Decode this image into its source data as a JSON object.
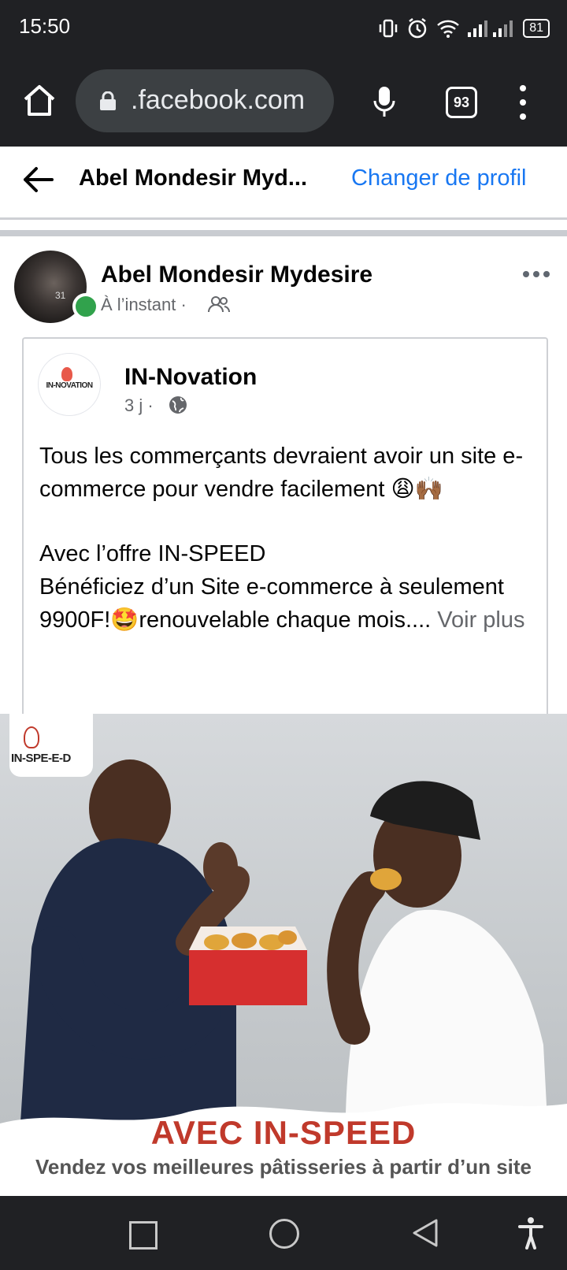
{
  "status_bar": {
    "time": "15:50",
    "battery": "81"
  },
  "browser": {
    "url": ".facebook.com",
    "tab_count": "93",
    "icons": [
      "home-icon",
      "lock-icon",
      "mic-icon",
      "tabs-icon",
      "more-vertical-icon"
    ]
  },
  "header": {
    "profile_name": "Abel Mondesir Myd...",
    "change_profile": "Changer de profil"
  },
  "post": {
    "author": "Abel Mondesir Mydesire",
    "time": "À l’instant",
    "audience_icon": "friends-icon",
    "avatar_badge": "31"
  },
  "shared": {
    "page_name": "IN-Novation",
    "page_logo_text": "IN-NOVATION",
    "time": "3 j",
    "text_line1": "Tous les commerçants devraient avoir un site e-commerce pour vendre facilement 😩🙌🏾",
    "text_line2": "Avec l’offre IN-SPEED",
    "text_line3": "Bénéficiez d’un Site e-commerce à seulement 9900F!🤩renouvelable chaque mois....",
    "see_more": "Voir plus"
  },
  "image": {
    "logo_text": "IN-SPE-E-D",
    "banner_title": "AVEC IN-SPEED",
    "banner_subtitle": "Vendez vos meilleures pâtisseries à partir d’un site"
  },
  "colors": {
    "link": "#1877f2",
    "online": "#31a24c",
    "banner_red": "#c0392b",
    "system_bar": "#202124"
  }
}
